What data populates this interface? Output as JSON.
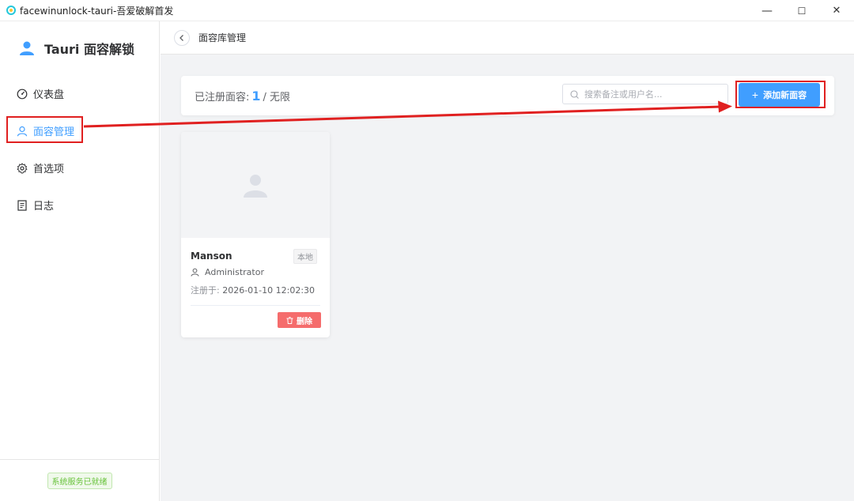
{
  "window": {
    "title": "facewinunlock-tauri-吾爱破解首发",
    "minimize": "—",
    "maximize": "☐",
    "close": "✕"
  },
  "sidebar": {
    "brand": "Tauri 面容解锁",
    "items": [
      {
        "label": "仪表盘",
        "icon": "dashboard-icon"
      },
      {
        "label": "面容管理",
        "icon": "user-icon",
        "active": true
      },
      {
        "label": "首选项",
        "icon": "gear-icon"
      },
      {
        "label": "日志",
        "icon": "document-icon"
      }
    ],
    "status": "系统服务已就绪"
  },
  "header": {
    "title": "面容库管理"
  },
  "toolbar": {
    "registered_label": "已注册面容:",
    "registered_count": "1",
    "limit": "/ 无限",
    "search_placeholder": "搜索备注或用户名...",
    "add_button": "添加新面容"
  },
  "faces": [
    {
      "name": "Manson",
      "tag": "本地",
      "user": "Administrator",
      "date_label": "注册于:",
      "date": "2026-01-10 12:02:30",
      "delete_label": "删除"
    }
  ],
  "colors": {
    "accent": "#409eff",
    "danger": "#f56c6c",
    "success": "#67c23a",
    "annotation": "#e02020"
  }
}
